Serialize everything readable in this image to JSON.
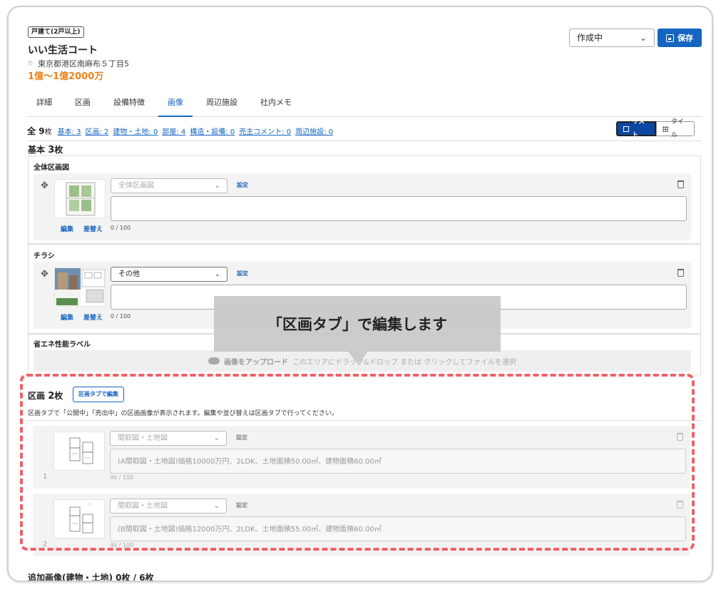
{
  "header": {
    "badge": "戸建て(2戸以上)",
    "title": "いい生活コート",
    "address": "東京都港区南麻布５丁目5",
    "price": "1億〜1億2000万",
    "status_value": "作成中",
    "save_label": "保存"
  },
  "tabs": [
    {
      "label": "詳細",
      "active": false
    },
    {
      "label": "区画",
      "active": false
    },
    {
      "label": "設備特徴",
      "active": false
    },
    {
      "label": "画像",
      "active": true
    },
    {
      "label": "周辺施設",
      "active": false
    },
    {
      "label": "社内メモ",
      "active": false
    }
  ],
  "counts": {
    "total_prefix": "全",
    "total_num": "9",
    "total_suffix": "枚",
    "links": [
      "基本: 3",
      "区画: 2",
      "建物・土地: 0",
      "部屋: 4",
      "構造・設備: 0",
      "売主コメント: 0",
      "周辺施設: 0"
    ]
  },
  "view_toggle": {
    "list": "リスト",
    "tile": "タイル"
  },
  "basic_section": {
    "title_prefix": "基本",
    "title_num": "3",
    "title_suffix": "枚",
    "groups": [
      {
        "label": "全体区画図",
        "category": "全体区画図",
        "set_label": "設定",
        "edit_label": "編集",
        "replace_label": "差替え",
        "counter": "0 / 100"
      },
      {
        "label": "チラシ",
        "category": "その他",
        "set_label": "設定",
        "edit_label": "編集",
        "replace_label": "差替え",
        "counter": "0 / 100"
      }
    ],
    "eco_label": "省エネ性能ラベル",
    "upload_strong": "画像をアップロード",
    "upload_rest": "このエリアにドラッグ&ドロップ または クリックしてファイルを選択"
  },
  "kukaku_section": {
    "title_prefix": "区画",
    "title_num": "2",
    "title_suffix": "枚",
    "edit_button": "区画タブで編集",
    "note": "区画タブで「公開中」「売出中」の区画画像が表示されます。編集や並び替えは区画タブで行ってください。",
    "items": [
      {
        "index": "1",
        "category": "間取図・土地図",
        "set_label": "設定",
        "comment": "(A間取図・土地図)価格10000万円、2LDK、土地面積50.00㎡、建物面積60.00㎡",
        "counter": "46 / 100"
      },
      {
        "index": "2",
        "category": "間取図・土地図",
        "set_label": "設定",
        "comment": "(B間取図・土地図)価格12000万円、2LDK、土地面積55.00㎡、建物面積60.00㎡",
        "counter": "46 / 100"
      }
    ]
  },
  "tooltip": "「区画タブ」で編集します",
  "cutoff_text": "追加画像(建物・土地) 0枚 / 6枚",
  "colors": {
    "accent": "#1565c0",
    "price": "#e8841a",
    "highlight": "#ef6068"
  }
}
